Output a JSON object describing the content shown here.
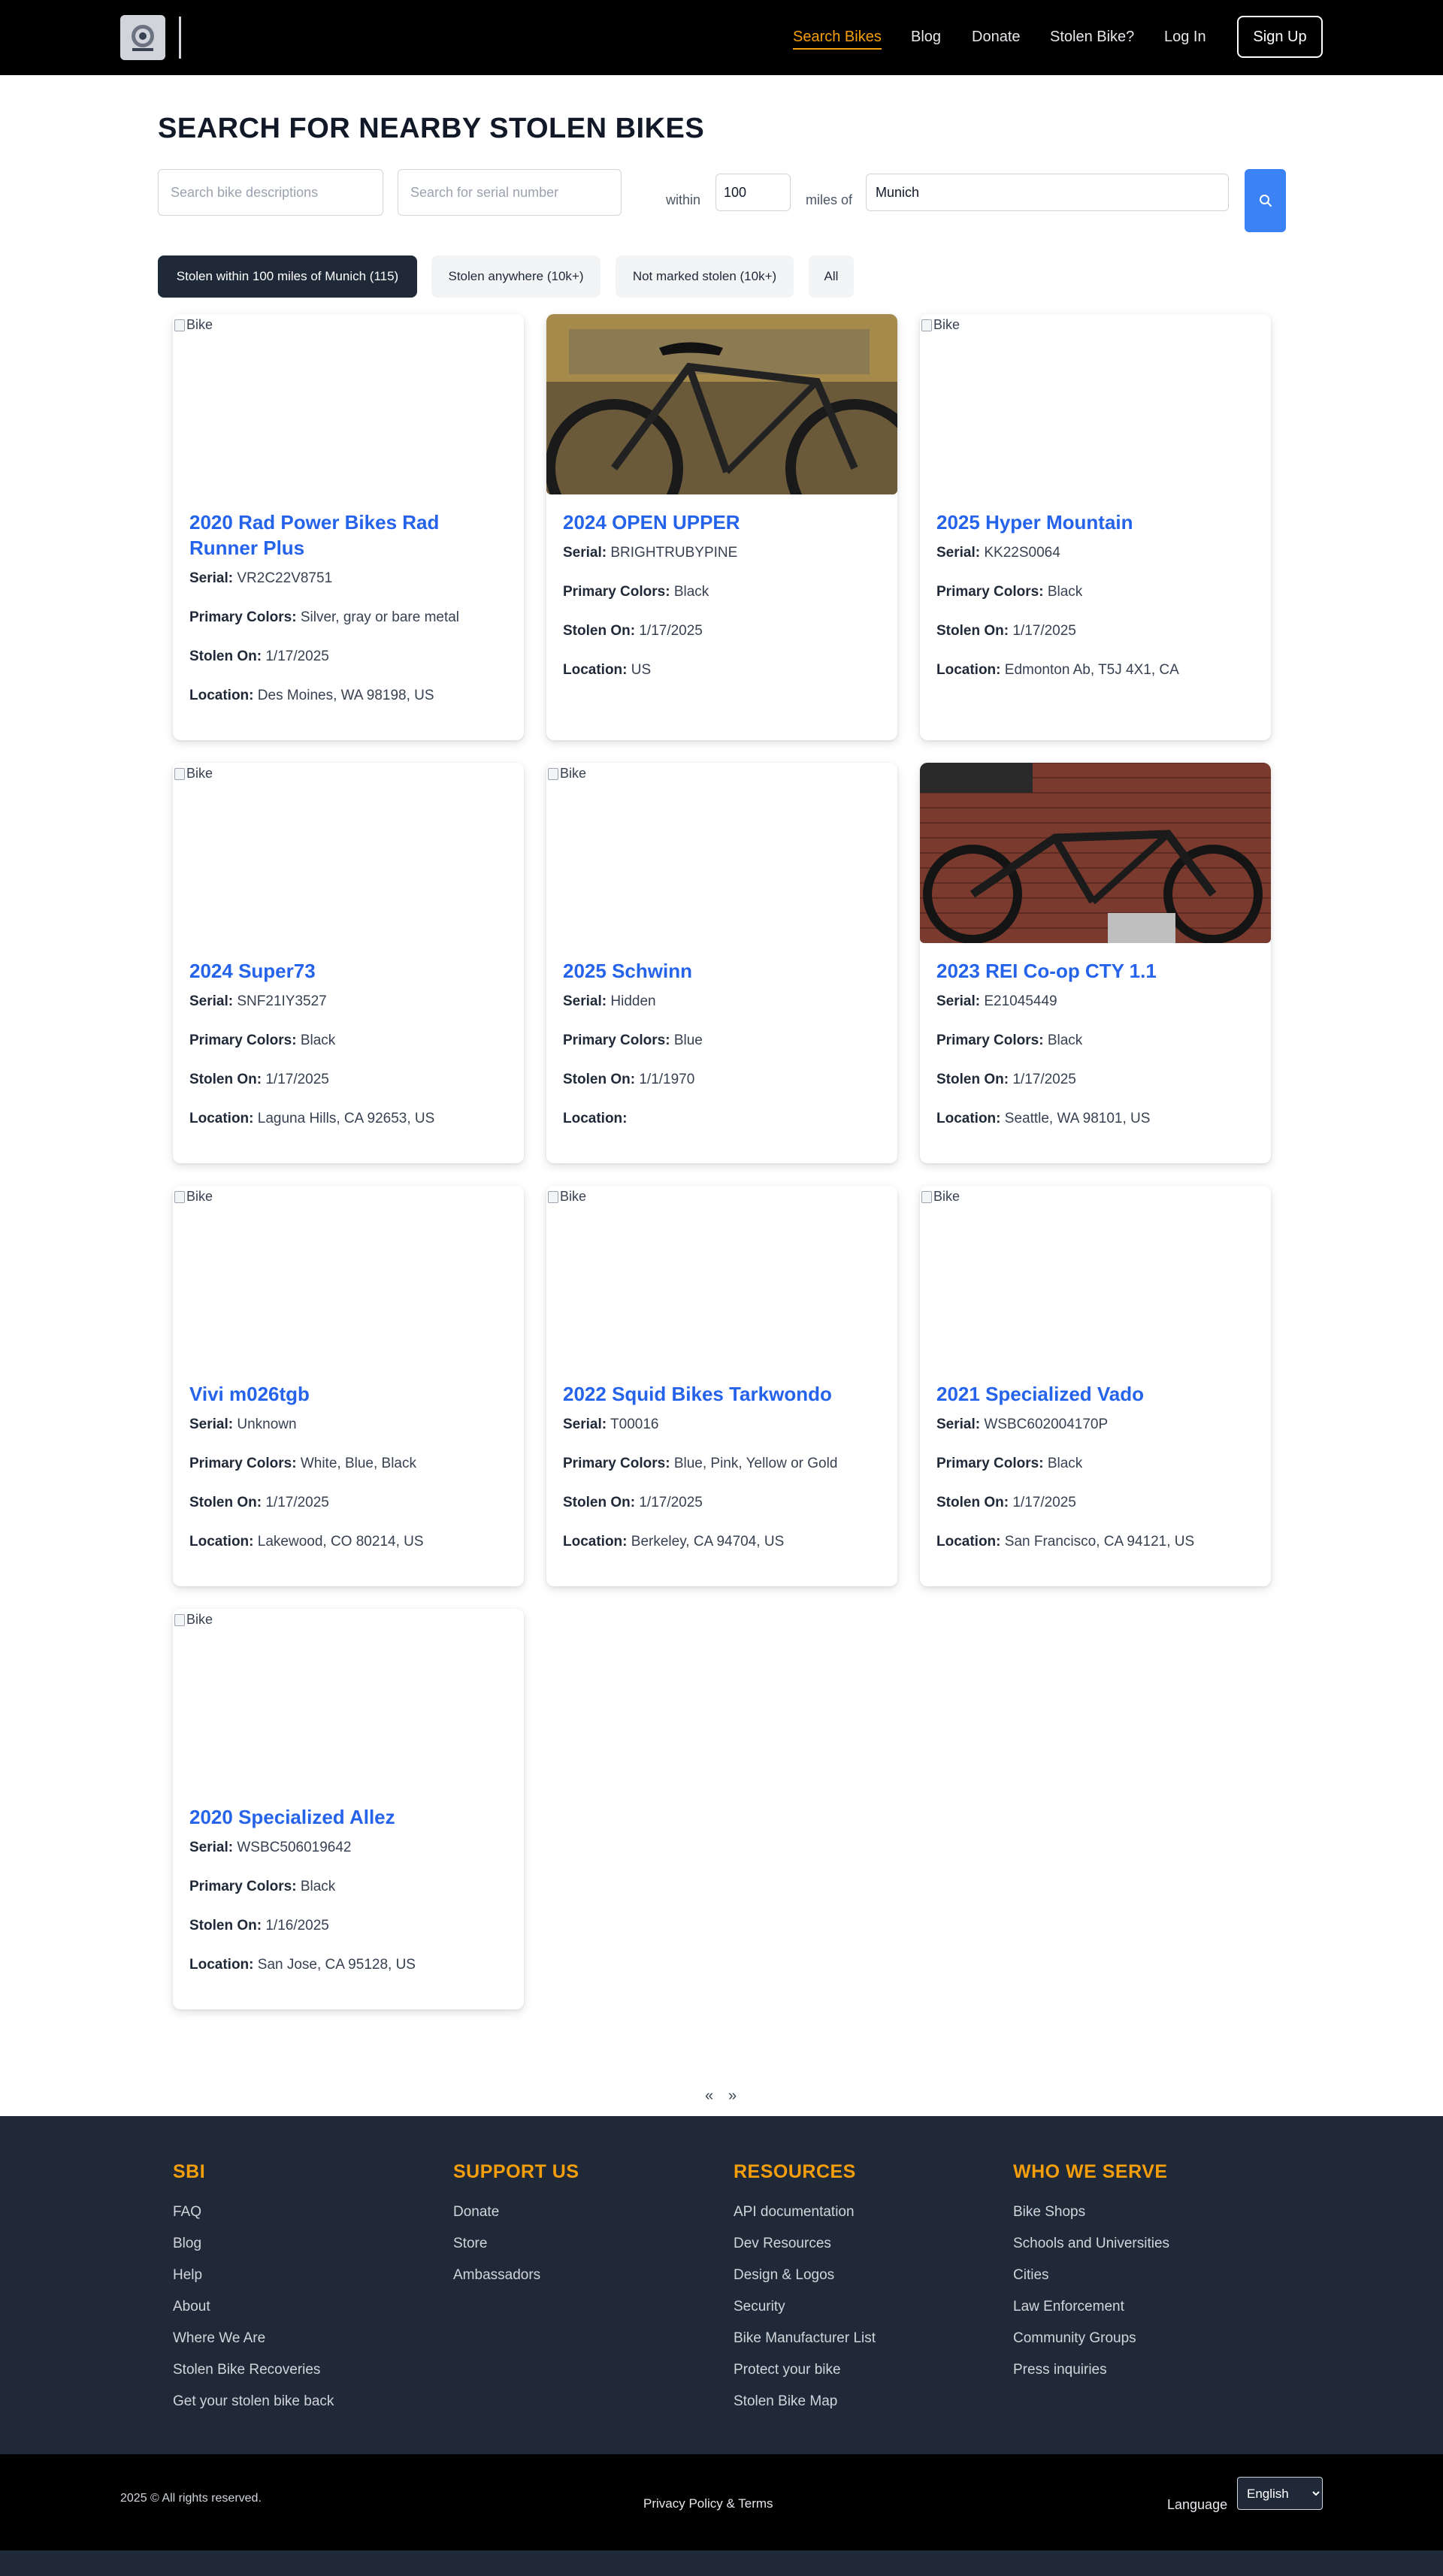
{
  "nav": {
    "links": [
      "Search Bikes",
      "Blog",
      "Donate",
      "Stolen Bike?",
      "Log In"
    ],
    "signup": "Sign Up"
  },
  "search": {
    "title": "SEARCH FOR NEARBY STOLEN BIKES",
    "description_placeholder": "Search bike descriptions",
    "serial_placeholder": "Search for serial number",
    "within_label": "within",
    "distance_value": "100",
    "miles_label": "miles of",
    "location_value": "Munich"
  },
  "tabs": [
    "Stolen within 100 miles of Munich (115)",
    "Stolen anywhere (10k+)",
    "Not marked stolen (10k+)",
    "All"
  ],
  "labels": {
    "serial": "Serial:",
    "colors": "Primary Colors:",
    "stolen_on": "Stolen On:",
    "location": "Location:",
    "image_alt": "Bike"
  },
  "bikes": [
    {
      "title": "2020 Rad Power Bikes Rad Runner Plus",
      "serial": "VR2C22V8751",
      "colors": "Silver, gray or bare metal",
      "stolen_on": "1/17/2025",
      "location": "Des Moines, WA 98198, US",
      "has_photo": false
    },
    {
      "title": "2024 OPEN UPPER",
      "serial": "BRIGHTRUBYPINE",
      "colors": "Black",
      "stolen_on": "1/17/2025",
      "location": "US",
      "has_photo": true
    },
    {
      "title": "2025 Hyper Mountain",
      "serial": "KK22S0064",
      "colors": "Black",
      "stolen_on": "1/17/2025",
      "location": "Edmonton Ab, T5J 4X1, CA",
      "has_photo": false
    },
    {
      "title": "2024 Super73",
      "serial": "SNF21IY3527",
      "colors": "Black",
      "stolen_on": "1/17/2025",
      "location": "Laguna Hills, CA 92653, US",
      "has_photo": false
    },
    {
      "title": "2025 Schwinn",
      "serial": "Hidden",
      "colors": "Blue",
      "stolen_on": "1/1/1970",
      "location": "",
      "has_photo": false
    },
    {
      "title": "2023 REI Co-op CTY 1.1",
      "serial": "E21045449",
      "colors": "Black",
      "stolen_on": "1/17/2025",
      "location": "Seattle, WA 98101, US",
      "has_photo": true
    },
    {
      "title": "Vivi m026tgb",
      "serial": "Unknown",
      "colors": "White, Blue, Black",
      "stolen_on": "1/17/2025",
      "location": "Lakewood, CO 80214, US",
      "has_photo": false
    },
    {
      "title": "2022 Squid Bikes Tarkwondo",
      "serial": "T00016",
      "colors": "Blue, Pink, Yellow or Gold",
      "stolen_on": "1/17/2025",
      "location": "Berkeley, CA 94704, US",
      "has_photo": false
    },
    {
      "title": "2021 Specialized Vado",
      "serial": "WSBC602004170P",
      "colors": "Black",
      "stolen_on": "1/17/2025",
      "location": "San Francisco, CA 94121, US",
      "has_photo": false
    },
    {
      "title": "2020 Specialized Allez",
      "serial": "WSBC506019642",
      "colors": "Black",
      "stolen_on": "1/16/2025",
      "location": "San Jose, CA 95128, US",
      "has_photo": false
    }
  ],
  "pagination": {
    "prev": "«",
    "next": "»"
  },
  "footer": {
    "columns": [
      {
        "heading": "SBI",
        "links": [
          "FAQ",
          "Blog",
          "Help",
          "About",
          "Where We Are",
          "Stolen Bike Recoveries",
          "Get your stolen bike back"
        ]
      },
      {
        "heading": "SUPPORT US",
        "links": [
          "Donate",
          "Store",
          "Ambassadors"
        ]
      },
      {
        "heading": "RESOURCES",
        "links": [
          "API documentation",
          "Dev Resources",
          "Design & Logos",
          "Security",
          "Bike Manufacturer List",
          "Protect your bike",
          "Stolen Bike Map"
        ]
      },
      {
        "heading": "WHO WE SERVE",
        "links": [
          "Bike Shops",
          "Schools and Universities",
          "Cities",
          "Law Enforcement",
          "Community Groups",
          "Press inquiries"
        ]
      }
    ],
    "copyright": "2025 © All rights reserved.",
    "terms": "Privacy Policy & Terms",
    "language_label": "Language",
    "language_value": "English"
  },
  "colors": {
    "accent": "#f59e0b",
    "link_blue": "#2563eb",
    "button_blue": "#3b82f6",
    "footer_bg": "#1f2937"
  }
}
